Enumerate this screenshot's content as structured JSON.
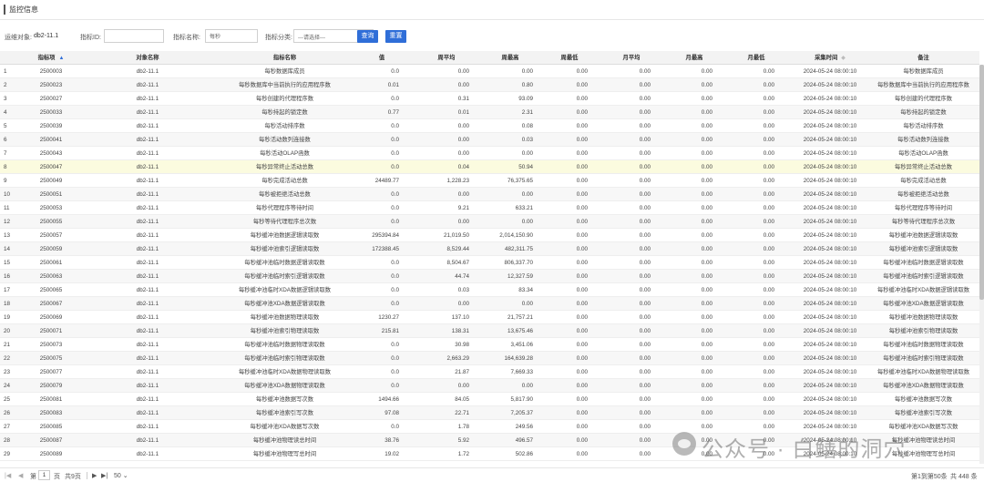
{
  "page": {
    "title": "监控信息"
  },
  "filters": {
    "target_label": "运维对象:",
    "target_value": "db2-11.1",
    "metric_id_label": "指标ID:",
    "metric_id_value": "",
    "metric_name_label": "指标名称:",
    "metric_name_value": "每秒",
    "category_label": "指标分类:",
    "category_selected": "---请选择---",
    "query_button": "查询",
    "reset_button": "重置"
  },
  "colors": {
    "accent": "#2f6ed8",
    "highlight_row": "#fbfbdf"
  },
  "table": {
    "headers": {
      "id": "指标项",
      "object": "对象名称",
      "name": "指标名称",
      "value": "值",
      "week_avg": "周平均",
      "week_max": "周最高",
      "week_min": "周最低",
      "month_avg": "月平均",
      "month_max": "月最高",
      "month_min": "月最低",
      "time": "采集时间",
      "note": "备注"
    },
    "highlighted_row": 8,
    "rows": [
      {
        "idx": "1",
        "id": "2500003",
        "obj": "db2-11.1",
        "name": "每秒数据库成员",
        "val": "0.0",
        "wavg": "0.00",
        "wmax": "0.00",
        "wmin": "0.00",
        "mavg": "0.00",
        "mmax": "0.00",
        "mmin": "0.00",
        "time": "2024-05-24 08:00:10",
        "note": "每秒数据库成员"
      },
      {
        "idx": "2",
        "id": "2500023",
        "obj": "db2-11.1",
        "name": "每秒数据库中当前执行的应用程序数",
        "val": "0.01",
        "wavg": "0.00",
        "wmax": "0.80",
        "wmin": "0.00",
        "mavg": "0.00",
        "mmax": "0.00",
        "mmin": "0.00",
        "time": "2024-05-24 08:00:10",
        "note": "每秒数据库中当前执行的应用程序数"
      },
      {
        "idx": "3",
        "id": "2500027",
        "obj": "db2-11.1",
        "name": "每秒创建的代理程序数",
        "val": "0.0",
        "wavg": "0.31",
        "wmax": "93.09",
        "wmin": "0.00",
        "mavg": "0.00",
        "mmax": "0.00",
        "mmin": "0.00",
        "time": "2024-05-24 08:00:10",
        "note": "每秒创建的代理程序数"
      },
      {
        "idx": "4",
        "id": "2500033",
        "obj": "db2-11.1",
        "name": "每秒持起的锁定数",
        "val": "0.77",
        "wavg": "0.01",
        "wmax": "2.31",
        "wmin": "0.00",
        "mavg": "0.00",
        "mmax": "0.00",
        "mmin": "0.00",
        "time": "2024-05-24 08:00:10",
        "note": "每秒持起的锁定数"
      },
      {
        "idx": "5",
        "id": "2500039",
        "obj": "db2-11.1",
        "name": "每秒活动排序数",
        "val": "0.0",
        "wavg": "0.00",
        "wmax": "0.08",
        "wmin": "0.00",
        "mavg": "0.00",
        "mmax": "0.00",
        "mmin": "0.00",
        "time": "2024-05-24 08:00:10",
        "note": "每秒活动排序数"
      },
      {
        "idx": "6",
        "id": "2500041",
        "obj": "db2-11.1",
        "name": "每秒活动数列连接数",
        "val": "0.0",
        "wavg": "0.00",
        "wmax": "0.03",
        "wmin": "0.00",
        "mavg": "0.00",
        "mmax": "0.00",
        "mmin": "0.00",
        "time": "2024-05-24 08:00:10",
        "note": "每秒活动数列连接数"
      },
      {
        "idx": "7",
        "id": "2500043",
        "obj": "db2-11.1",
        "name": "每秒活动OLAP函数",
        "val": "0.0",
        "wavg": "0.00",
        "wmax": "0.00",
        "wmin": "0.00",
        "mavg": "0.00",
        "mmax": "0.00",
        "mmin": "0.00",
        "time": "2024-05-24 08:00:10",
        "note": "每秒活动OLAP函数"
      },
      {
        "idx": "8",
        "id": "2500047",
        "obj": "db2-11.1",
        "name": "每秒异常终止活动总数",
        "val": "0.0",
        "wavg": "0.04",
        "wmax": "50.94",
        "wmin": "0.00",
        "mavg": "0.00",
        "mmax": "0.00",
        "mmin": "0.00",
        "time": "2024-05-24 08:00:10",
        "note": "每秒异常终止活动总数"
      },
      {
        "idx": "9",
        "id": "2500049",
        "obj": "db2-11.1",
        "name": "每秒完成活动总数",
        "val": "24489.77",
        "wavg": "1,228.23",
        "wmax": "76,375.65",
        "wmin": "0.00",
        "mavg": "0.00",
        "mmax": "0.00",
        "mmin": "0.00",
        "time": "2024-05-24 08:00:10",
        "note": "每秒完成活动总数"
      },
      {
        "idx": "10",
        "id": "2500051",
        "obj": "db2-11.1",
        "name": "每秒被拒绝活动总数",
        "val": "0.0",
        "wavg": "0.00",
        "wmax": "0.00",
        "wmin": "0.00",
        "mavg": "0.00",
        "mmax": "0.00",
        "mmin": "0.00",
        "time": "2024-05-24 08:00:10",
        "note": "每秒被拒绝活动总数"
      },
      {
        "idx": "11",
        "id": "2500053",
        "obj": "db2-11.1",
        "name": "每秒代理程序等待时间",
        "val": "0.0",
        "wavg": "9.21",
        "wmax": "633.21",
        "wmin": "0.00",
        "mavg": "0.00",
        "mmax": "0.00",
        "mmin": "0.00",
        "time": "2024-05-24 08:00:10",
        "note": "每秒代理程序等待时间"
      },
      {
        "idx": "12",
        "id": "2500055",
        "obj": "db2-11.1",
        "name": "每秒等待代理程序总次数",
        "val": "0.0",
        "wavg": "0.00",
        "wmax": "0.00",
        "wmin": "0.00",
        "mavg": "0.00",
        "mmax": "0.00",
        "mmin": "0.00",
        "time": "2024-05-24 08:00:10",
        "note": "每秒等待代理程序总次数"
      },
      {
        "idx": "13",
        "id": "2500057",
        "obj": "db2-11.1",
        "name": "每秒缓冲池数据逻辑读取数",
        "val": "295394.84",
        "wavg": "21,019.50",
        "wmax": "2,014,150.90",
        "wmin": "0.00",
        "mavg": "0.00",
        "mmax": "0.00",
        "mmin": "0.00",
        "time": "2024-05-24 08:00:10",
        "note": "每秒缓冲池数据逻辑读取数"
      },
      {
        "idx": "14",
        "id": "2500059",
        "obj": "db2-11.1",
        "name": "每秒缓冲池索引逻辑读取数",
        "val": "172388.45",
        "wavg": "8,529.44",
        "wmax": "482,311.75",
        "wmin": "0.00",
        "mavg": "0.00",
        "mmax": "0.00",
        "mmin": "0.00",
        "time": "2024-05-24 08:00:10",
        "note": "每秒缓冲池索引逻辑读取数"
      },
      {
        "idx": "15",
        "id": "2500061",
        "obj": "db2-11.1",
        "name": "每秒缓冲池临时数据逻辑读取数",
        "val": "0.0",
        "wavg": "8,504.67",
        "wmax": "806,337.70",
        "wmin": "0.00",
        "mavg": "0.00",
        "mmax": "0.00",
        "mmin": "0.00",
        "time": "2024-05-24 08:00:10",
        "note": "每秒缓冲池临时数据逻辑读取数"
      },
      {
        "idx": "16",
        "id": "2500063",
        "obj": "db2-11.1",
        "name": "每秒缓冲池临时索引逻辑读取数",
        "val": "0.0",
        "wavg": "44.74",
        "wmax": "12,327.59",
        "wmin": "0.00",
        "mavg": "0.00",
        "mmax": "0.00",
        "mmin": "0.00",
        "time": "2024-05-24 08:00:10",
        "note": "每秒缓冲池临时索引逻辑读取数"
      },
      {
        "idx": "17",
        "id": "2500065",
        "obj": "db2-11.1",
        "name": "每秒缓冲池临时XDA数据逻辑读取数",
        "val": "0.0",
        "wavg": "0.03",
        "wmax": "83.34",
        "wmin": "0.00",
        "mavg": "0.00",
        "mmax": "0.00",
        "mmin": "0.00",
        "time": "2024-05-24 08:00:10",
        "note": "每秒缓冲池临时XDA数据逻辑读取数"
      },
      {
        "idx": "18",
        "id": "2500067",
        "obj": "db2-11.1",
        "name": "每秒缓冲池XDA数据逻辑读取数",
        "val": "0.0",
        "wavg": "0.00",
        "wmax": "0.00",
        "wmin": "0.00",
        "mavg": "0.00",
        "mmax": "0.00",
        "mmin": "0.00",
        "time": "2024-05-24 08:00:10",
        "note": "每秒缓冲池XDA数据逻辑读取数"
      },
      {
        "idx": "19",
        "id": "2500069",
        "obj": "db2-11.1",
        "name": "每秒缓冲池数据物理读取数",
        "val": "1230.27",
        "wavg": "137.10",
        "wmax": "21,757.21",
        "wmin": "0.00",
        "mavg": "0.00",
        "mmax": "0.00",
        "mmin": "0.00",
        "time": "2024-05-24 08:00:10",
        "note": "每秒缓冲池数据物理读取数"
      },
      {
        "idx": "20",
        "id": "2500071",
        "obj": "db2-11.1",
        "name": "每秒缓冲池索引物理读取数",
        "val": "215.81",
        "wavg": "138.31",
        "wmax": "13,675.46",
        "wmin": "0.00",
        "mavg": "0.00",
        "mmax": "0.00",
        "mmin": "0.00",
        "time": "2024-05-24 08:00:10",
        "note": "每秒缓冲池索引物理读取数"
      },
      {
        "idx": "21",
        "id": "2500073",
        "obj": "db2-11.1",
        "name": "每秒缓冲池临时数据物理读取数",
        "val": "0.0",
        "wavg": "30.98",
        "wmax": "3,451.06",
        "wmin": "0.00",
        "mavg": "0.00",
        "mmax": "0.00",
        "mmin": "0.00",
        "time": "2024-05-24 08:00:10",
        "note": "每秒缓冲池临时数据物理读取数"
      },
      {
        "idx": "22",
        "id": "2500075",
        "obj": "db2-11.1",
        "name": "每秒缓冲池临时索引物理读取数",
        "val": "0.0",
        "wavg": "2,663.29",
        "wmax": "164,639.28",
        "wmin": "0.00",
        "mavg": "0.00",
        "mmax": "0.00",
        "mmin": "0.00",
        "time": "2024-05-24 08:00:10",
        "note": "每秒缓冲池临时索引物理读取数"
      },
      {
        "idx": "23",
        "id": "2500077",
        "obj": "db2-11.1",
        "name": "每秒缓冲池临时XDA数据物理读取数",
        "val": "0.0",
        "wavg": "21.87",
        "wmax": "7,669.33",
        "wmin": "0.00",
        "mavg": "0.00",
        "mmax": "0.00",
        "mmin": "0.00",
        "time": "2024-05-24 08:00:10",
        "note": "每秒缓冲池临时XDA数据物理读取数"
      },
      {
        "idx": "24",
        "id": "2500079",
        "obj": "db2-11.1",
        "name": "每秒缓冲池XDA数据物理读取数",
        "val": "0.0",
        "wavg": "0.00",
        "wmax": "0.00",
        "wmin": "0.00",
        "mavg": "0.00",
        "mmax": "0.00",
        "mmin": "0.00",
        "time": "2024-05-24 08:00:10",
        "note": "每秒缓冲池XDA数据物理读取数"
      },
      {
        "idx": "25",
        "id": "2500081",
        "obj": "db2-11.1",
        "name": "每秒缓冲池数据写次数",
        "val": "1494.66",
        "wavg": "84.05",
        "wmax": "5,817.90",
        "wmin": "0.00",
        "mavg": "0.00",
        "mmax": "0.00",
        "mmin": "0.00",
        "time": "2024-05-24 08:00:10",
        "note": "每秒缓冲池数据写次数"
      },
      {
        "idx": "26",
        "id": "2500083",
        "obj": "db2-11.1",
        "name": "每秒缓冲池索引写次数",
        "val": "97.08",
        "wavg": "22.71",
        "wmax": "7,205.37",
        "wmin": "0.00",
        "mavg": "0.00",
        "mmax": "0.00",
        "mmin": "0.00",
        "time": "2024-05-24 08:00:10",
        "note": "每秒缓冲池索引写次数"
      },
      {
        "idx": "27",
        "id": "2500085",
        "obj": "db2-11.1",
        "name": "每秒缓冲池XDA数据写次数",
        "val": "0.0",
        "wavg": "1.78",
        "wmax": "249.56",
        "wmin": "0.00",
        "mavg": "0.00",
        "mmax": "0.00",
        "mmin": "0.00",
        "time": "2024-05-24 08:00:10",
        "note": "每秒缓冲池XDA数据写次数"
      },
      {
        "idx": "28",
        "id": "2500087",
        "obj": "db2-11.1",
        "name": "每秒缓冲池物理读总时间",
        "val": "38.76",
        "wavg": "5.92",
        "wmax": "496.57",
        "wmin": "0.00",
        "mavg": "0.00",
        "mmax": "0.00",
        "mmin": "0.00",
        "time": "2024-05-24 08:00:10",
        "note": "每秒缓冲池物理读总时间"
      },
      {
        "idx": "29",
        "id": "2500089",
        "obj": "db2-11.1",
        "name": "每秒缓冲池物理写总时间",
        "val": "19.02",
        "wavg": "1.72",
        "wmax": "502.86",
        "wmin": "0.00",
        "mavg": "0.00",
        "mmax": "0.00",
        "mmin": "0.00",
        "time": "2024-05-24 08:00:10",
        "note": "每秒缓冲池物理写总时间"
      }
    ]
  },
  "pager": {
    "prev_page_label": "第",
    "current_page": "1",
    "page_unit_label": "页",
    "total_pages_label": "共9页",
    "page_size": "50",
    "range_label": "第1到第50条",
    "total_label": "共 448 条"
  },
  "watermark": {
    "text": "公众号 · 白鳝的洞穴"
  }
}
